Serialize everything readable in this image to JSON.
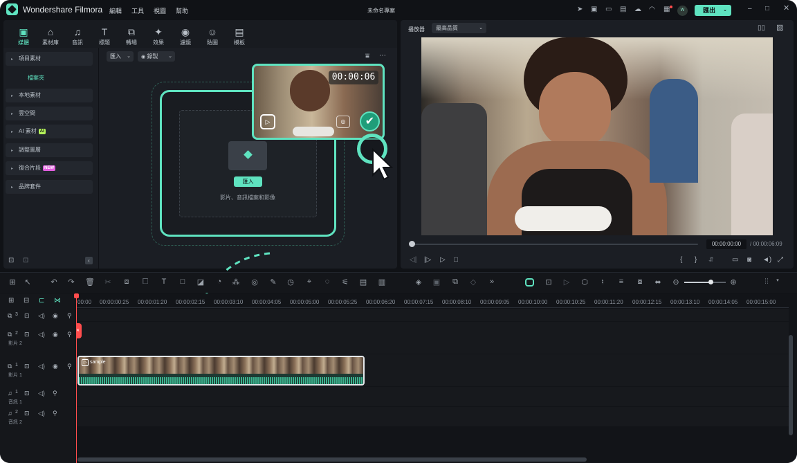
{
  "app": {
    "name": "Wondershare Filmora",
    "project": "未命名專案",
    "export_label": "匯出",
    "avatar": "W"
  },
  "menu": [
    "編輯",
    "工具",
    "視圖",
    "幫助"
  ],
  "categories": [
    "媒體",
    "素材庫",
    "音訊",
    "標題",
    "轉場",
    "效果",
    "濾鏡",
    "貼圖",
    "模板"
  ],
  "sidebar": {
    "items": [
      "項目素材",
      "本地素材",
      "雲空間",
      "AI 素材",
      "調整圖層",
      "復合片段",
      "品牌套件"
    ],
    "folder": "檔案夾",
    "badges": {
      "ai": "AI",
      "new": "NEW"
    }
  },
  "media": {
    "import_dd": "匯入",
    "record_dd": "錄製",
    "import_btn": "匯入",
    "hint": "影片、音訊檔案和影像",
    "thumb_time": "00:00:06"
  },
  "player": {
    "label": "播放器",
    "quality": "最高品質",
    "current": "00:00:00:00",
    "total": "/ 00:00:06:09",
    "brace_open": "{",
    "brace_close": "}",
    "progress": 0.0
  },
  "timeline": {
    "ticks": [
      "00:00",
      "00:00:00:25",
      "00:00:01:20",
      "00:00:02:15",
      "00:00:03:10",
      "00:00:04:05",
      "00:00:05:00",
      "00:00:05:25",
      "00:00:06:20",
      "00:00:07:15",
      "00:00:08:10",
      "00:00:09:05",
      "00:00:10:00",
      "00:00:10:25",
      "00:00:11:20",
      "00:00:12:15",
      "00:00:13:10",
      "00:00:14:05",
      "00:00:15:00"
    ],
    "tracks": [
      {
        "num": "3",
        "label": ""
      },
      {
        "num": "2",
        "label": "影片 2"
      },
      {
        "num": "1",
        "label": "影片 1"
      },
      {
        "num": "1",
        "label": "音訊 1"
      },
      {
        "num": "2",
        "label": "音訊 2"
      }
    ],
    "clip_name": "sample"
  },
  "colors": {
    "accent": "#5fe3c0",
    "bg": "#101216",
    "panel": "#1b1e24",
    "playhead": "#ff4d4d",
    "ai_badge": "#b4f25a",
    "new_badge": "#e35fe0"
  }
}
